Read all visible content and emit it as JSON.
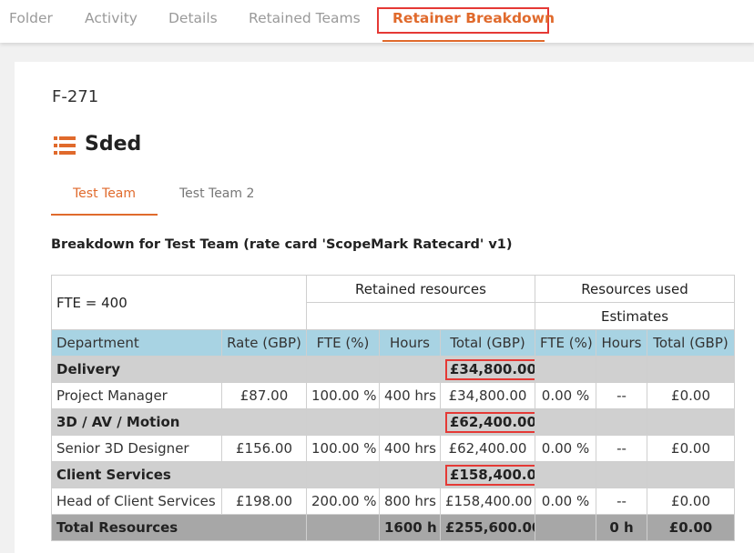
{
  "top_tabs": [
    "Folder",
    "Activity",
    "Details",
    "Retained Teams",
    "Retainer Breakdown"
  ],
  "folder_id": "F-271",
  "retainer_name": "Sded",
  "team_tabs": [
    "Test Team",
    "Test Team 2"
  ],
  "breakdown_heading": "Breakdown for Test Team (rate card 'ScopeMark Ratecard' v1)",
  "table": {
    "fte_label": "FTE = 400",
    "retained_header": "Retained resources",
    "used_header": "Resources used",
    "estimates_header": "Estimates",
    "columns": [
      "Department",
      "Rate (GBP)",
      "FTE (%)",
      "Hours",
      "Total (GBP)",
      "FTE (%)",
      "Hours",
      "Total (GBP)"
    ],
    "groups": [
      {
        "name": "Delivery",
        "total": "£34,800.00",
        "item": {
          "name": "Project Manager",
          "rate": "£87.00",
          "fte": "100.00 %",
          "hours": "400 hrs",
          "total": "£34,800.00",
          "used_fte": "0.00 %",
          "used_hours": "--",
          "used_total": "£0.00"
        }
      },
      {
        "name": "3D / AV / Motion",
        "total": "£62,400.00",
        "item": {
          "name": "Senior 3D Designer",
          "rate": "£156.00",
          "fte": "100.00 %",
          "hours": "400 hrs",
          "total": "£62,400.00",
          "used_fte": "0.00 %",
          "used_hours": "--",
          "used_total": "£0.00"
        }
      },
      {
        "name": "Client Services",
        "total": "£158,400.00",
        "item": {
          "name": "Head of Client Services",
          "rate": "£198.00",
          "fte": "200.00 %",
          "hours": "800 hrs",
          "total": "£158,400.00",
          "used_fte": "0.00 %",
          "used_hours": "--",
          "used_total": "£0.00"
        }
      }
    ],
    "totals": {
      "label": "Total Resources",
      "hours": "1600 h",
      "total": "£255,600.00",
      "used_hours": "0 h",
      "used_total": "£0.00"
    }
  },
  "colors": {
    "accent": "#e06a2c",
    "highlight": "#e53935",
    "header_blue": "#a8d3e3",
    "group_gray": "#d0d0d0",
    "total_gray": "#a7a7a7"
  }
}
